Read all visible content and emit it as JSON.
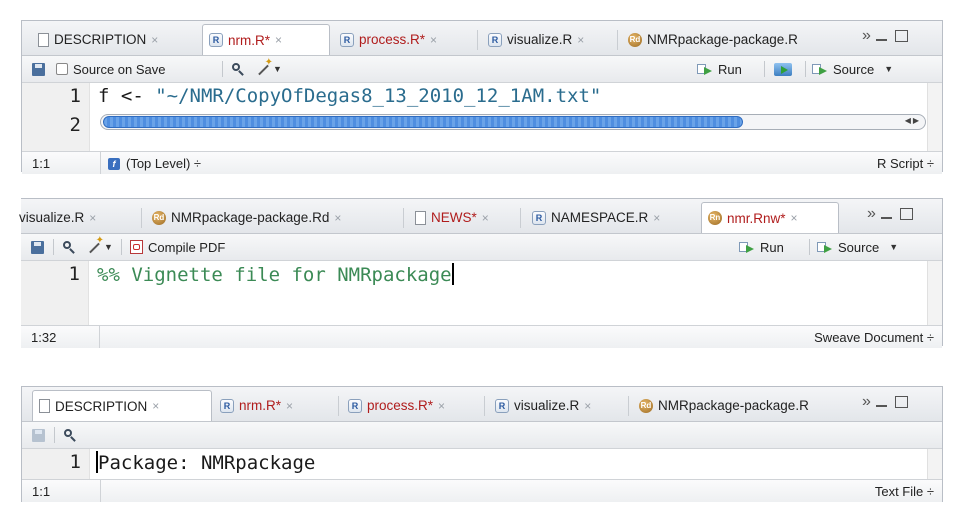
{
  "pane1": {
    "tabs": [
      {
        "label": "DESCRIPTION",
        "icon": "document-icon",
        "modified": false
      },
      {
        "label": "nrm.R*",
        "icon": "r-file-icon",
        "modified": true
      },
      {
        "label": "process.R*",
        "icon": "r-file-icon",
        "modified": true
      },
      {
        "label": "visualize.R",
        "icon": "r-file-icon",
        "modified": false
      },
      {
        "label": "NMRpackage-package.R",
        "icon": "rd-file-icon",
        "modified": false
      }
    ],
    "active_tab": 1,
    "overflow": "»",
    "toolbar": {
      "source_on_save": "Source on Save",
      "run": "Run",
      "source": "Source"
    },
    "lines": [
      "1",
      "2"
    ],
    "code_line1_prefix": "f <- ",
    "code_line1_string": "\"~/NMR/CopyOfDegas8_13_2010_12_1AM.txt\"",
    "status": {
      "position": "1:1",
      "scope": "(Top Level) ÷",
      "file_type": "R Script ÷"
    }
  },
  "pane2": {
    "tabs": [
      {
        "label": "visualize.R",
        "icon": "none",
        "modified": false
      },
      {
        "label": "NMRpackage-package.Rd",
        "icon": "rd-file-icon",
        "modified": false
      },
      {
        "label": "NEWS*",
        "icon": "document-icon",
        "modified": true
      },
      {
        "label": "NAMESPACE.R",
        "icon": "r-file-icon",
        "modified": false
      },
      {
        "label": "nmr.Rnw*",
        "icon": "rd-file-icon",
        "modified": true
      }
    ],
    "active_tab": 4,
    "overflow": "»",
    "toolbar": {
      "compile_pdf": "Compile PDF",
      "run": "Run",
      "source": "Source"
    },
    "lines": [
      "1"
    ],
    "code_line1": "%% Vignette file for NMRpackage",
    "status": {
      "position": "1:32",
      "file_type": "Sweave Document ÷"
    }
  },
  "pane3": {
    "tabs": [
      {
        "label": "DESCRIPTION",
        "icon": "document-icon",
        "modified": false
      },
      {
        "label": "nrm.R*",
        "icon": "r-file-icon",
        "modified": true
      },
      {
        "label": "process.R*",
        "icon": "r-file-icon",
        "modified": true
      },
      {
        "label": "visualize.R",
        "icon": "r-file-icon",
        "modified": false
      },
      {
        "label": "NMRpackage-package.R",
        "icon": "rd-file-icon",
        "modified": false
      }
    ],
    "active_tab": 0,
    "overflow": "»",
    "lines": [
      "1"
    ],
    "code_line1": "Package: NMRpackage",
    "status": {
      "position": "1:1",
      "file_type": "Text File ÷"
    }
  },
  "close_glyph": "×",
  "colors": {
    "modified_tab_text": "#b01c1c",
    "string": "#2a6c8e",
    "comment": "#3b8a55",
    "run_arrow": "#3fa043"
  }
}
